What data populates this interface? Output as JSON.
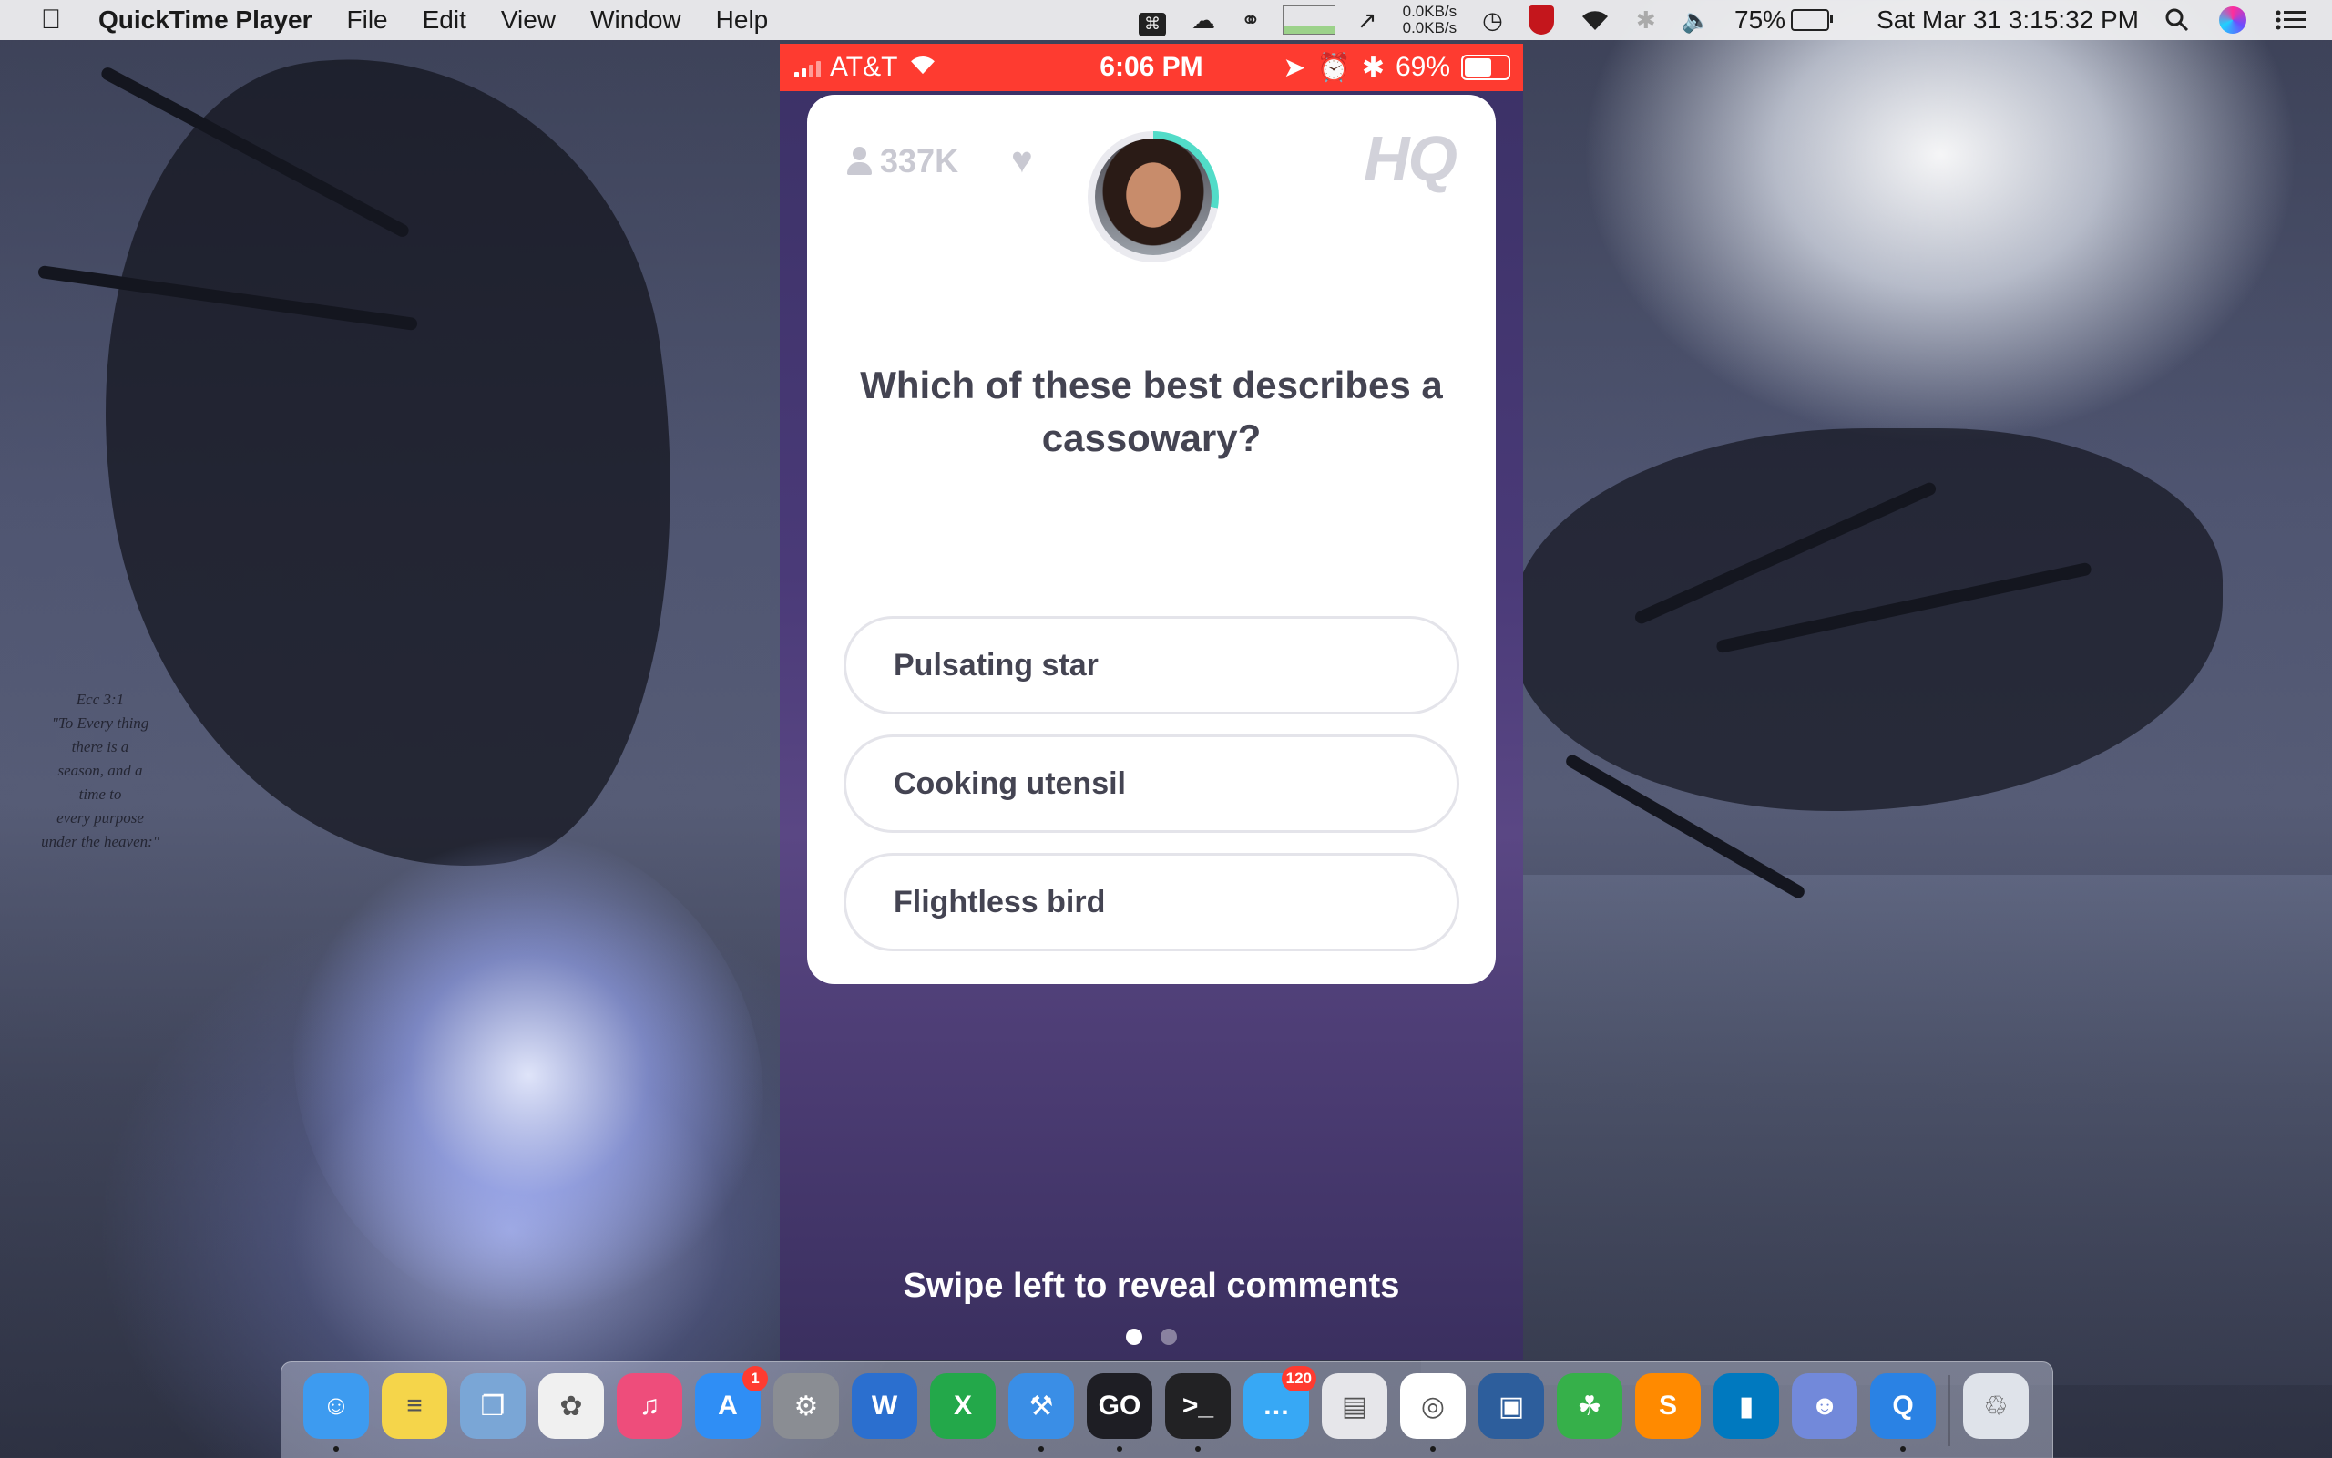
{
  "menubar": {
    "app_name": "QuickTime Player",
    "menus": [
      "File",
      "Edit",
      "View",
      "Window",
      "Help"
    ],
    "net_up": "0.0KB/s",
    "net_down": "0.0KB/s",
    "battery": "75%",
    "datetime": "Sat Mar 31  3:15:32 PM"
  },
  "wallpaper": {
    "verse": [
      "Ecc 3:1",
      "\"To Every thing",
      "there is a",
      "season, and a",
      "time to",
      "every purpose",
      "under the heaven:\""
    ]
  },
  "phone": {
    "status": {
      "carrier": "AT&T",
      "time": "6:06 PM",
      "battery": "69%",
      "battery_level": 0.69,
      "bar_color": "#fe3b30"
    },
    "viewers": "337K",
    "logo": "HQ",
    "question": "Which of these best describes a cassowary?",
    "answers": [
      "Pulsating star",
      "Cooking utensil",
      "Flightless bird"
    ],
    "footer": "Swipe left to reveal comments",
    "page_count": 2,
    "active_page": 1
  },
  "dock": {
    "apps": [
      {
        "name": "Finder",
        "icon": "finder-icon",
        "color": "#3d9bf0",
        "running": true
      },
      {
        "name": "Notes",
        "icon": "notes-icon",
        "color": "#f5d54a",
        "running": false
      },
      {
        "name": "Preview",
        "icon": "preview-icon",
        "color": "#7aa6d6",
        "running": false
      },
      {
        "name": "Photos",
        "icon": "photos-icon",
        "color": "#f0f0f0",
        "running": false
      },
      {
        "name": "iTunes",
        "icon": "itunes-icon",
        "color": "#ee4d7b",
        "running": false
      },
      {
        "name": "App Store",
        "icon": "app-store-icon",
        "color": "#2f8ef5",
        "running": false,
        "badge": "1"
      },
      {
        "name": "System Preferences",
        "icon": "system-preferences-icon",
        "color": "#8a8d93",
        "running": false
      },
      {
        "name": "Word",
        "icon": "word-icon",
        "color": "#2b6fcf",
        "running": false
      },
      {
        "name": "Excel",
        "icon": "excel-icon",
        "color": "#23a84a",
        "running": false
      },
      {
        "name": "Xcode",
        "icon": "xcode-icon",
        "color": "#3a8ee6",
        "running": true
      },
      {
        "name": "GoLand",
        "icon": "goland-icon",
        "color": "#1e1e24",
        "running": true
      },
      {
        "name": "Terminal",
        "icon": "terminal-icon",
        "color": "#222224",
        "running": true
      },
      {
        "name": "Messages",
        "icon": "messages-icon",
        "color": "#37a8f5",
        "running": false,
        "badge": "120"
      },
      {
        "name": "Photo Browser",
        "icon": "photo-browser-icon",
        "color": "#e6e6ea",
        "running": false
      },
      {
        "name": "Chrome",
        "icon": "chrome-icon",
        "color": "#ffffff",
        "running": true
      },
      {
        "name": "VirtualBox",
        "icon": "virtualbox-icon",
        "color": "#2d5e9c",
        "running": false
      },
      {
        "name": "Evernote",
        "icon": "evernote-icon",
        "color": "#36b04a",
        "running": false
      },
      {
        "name": "Sublime",
        "icon": "sublime-icon",
        "color": "#ff8a00",
        "running": false
      },
      {
        "name": "Trello",
        "icon": "trello-icon",
        "color": "#0079bf",
        "running": false
      },
      {
        "name": "Discord",
        "icon": "discord-icon",
        "color": "#7289da",
        "running": false
      },
      {
        "name": "QuickTime",
        "icon": "quicktime-icon",
        "color": "#2a82e4",
        "running": true
      },
      {
        "name": "Trash",
        "icon": "trash-icon",
        "color": "#dfe3ea",
        "running": false
      }
    ]
  }
}
